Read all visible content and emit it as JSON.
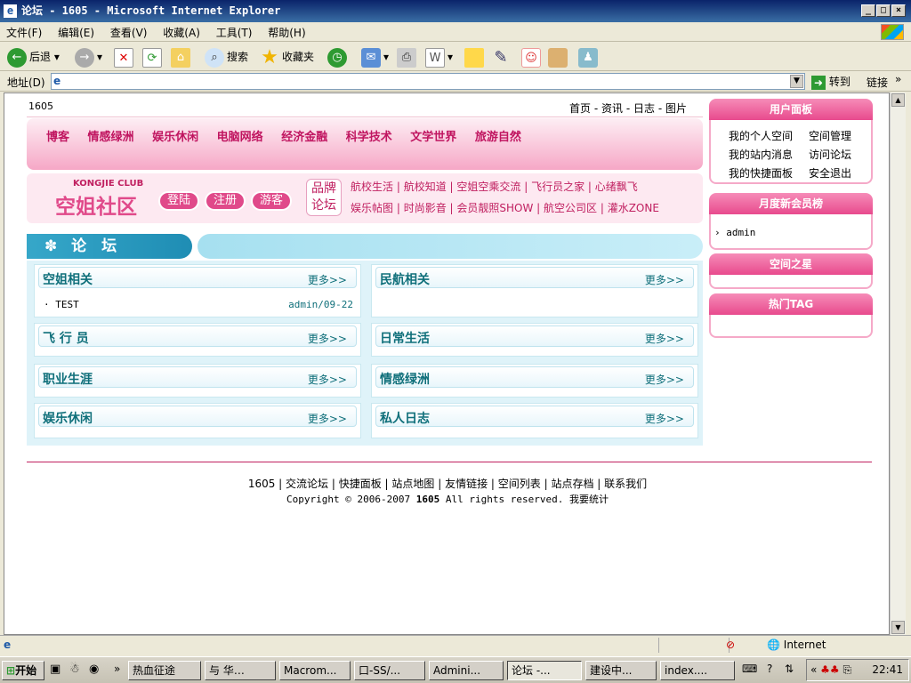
{
  "window": {
    "title": "论坛 - 1605 - Microsoft Internet Explorer",
    "menu": [
      "文件(F)",
      "编辑(E)",
      "查看(V)",
      "收藏(A)",
      "工具(T)",
      "帮助(H)"
    ],
    "toolbar": {
      "back": "后退",
      "search": "搜索",
      "favorites": "收藏夹"
    },
    "address_label": "地址(D)",
    "address_value": "",
    "go": "转到",
    "links": "链接"
  },
  "page": {
    "site_num": "1605",
    "topnav": [
      "首页",
      "资讯",
      "日志",
      "图片"
    ],
    "categories": [
      "博客",
      "情感绿洲",
      "娱乐休闲",
      "电脑网络",
      "经济金融",
      "科学技术",
      "文学世界",
      "旅游自然"
    ],
    "logo_en": "KONGJIE CLUB",
    "logo_cn": "空姐社区",
    "btn_login": "登陆",
    "btn_register": "注册",
    "btn_guest": "游客",
    "brand_label_1": "品牌",
    "brand_label_2": "论坛",
    "brand_links_row1": [
      "航校生活",
      "航校知道",
      "空姐空乘交流",
      "飞行员之家",
      "心绪飘飞"
    ],
    "brand_links_row2": [
      "娱乐帖图",
      "时尚影音",
      "会员靓照SHOW",
      "航空公司区",
      "灌水ZONE"
    ],
    "forum_title": "论　坛",
    "forums": [
      {
        "title": "空姐相关",
        "more": "更多>>",
        "posts": [
          {
            "title": "TEST",
            "meta": "admin/09-22"
          }
        ]
      },
      {
        "title": "民航相关",
        "more": "更多>>",
        "posts": []
      },
      {
        "title": "飞 行 员",
        "more": "更多>>",
        "posts": []
      },
      {
        "title": "日常生活",
        "more": "更多>>",
        "posts": []
      },
      {
        "title": "职业生涯",
        "more": "更多>>",
        "posts": []
      },
      {
        "title": "情感绿洲",
        "more": "更多>>",
        "posts": []
      },
      {
        "title": "娱乐休闲",
        "more": "更多>>",
        "posts": []
      },
      {
        "title": "私人日志",
        "more": "更多>>",
        "posts": []
      }
    ],
    "side": {
      "user_panel": "用户面板",
      "user_links": [
        "我的个人空间",
        "空间管理",
        "我的站内消息",
        "访问论坛",
        "我的快捷面板",
        "安全退出"
      ],
      "monthly": "月度新会员榜",
      "monthly_items": [
        "admin"
      ],
      "star": "空间之星",
      "hot_tag": "热门TAG"
    },
    "footer_links": [
      "1605",
      "交流论坛",
      "快捷面板",
      "站点地图",
      "友情链接",
      "空间列表",
      "站点存档",
      "联系我们"
    ],
    "copyright_pre": "Copyright © 2006-2007 ",
    "copyright_brand": "1605",
    "copyright_post": " All rights reserved. 我要统计"
  },
  "status": {
    "zone": "Internet"
  },
  "taskbar": {
    "start": "开始",
    "tasks": [
      "热血征途",
      "与 华…",
      "Macrom...",
      "口-SS/...",
      "Admini...",
      "论坛 -...",
      "建设中...",
      "index...."
    ],
    "clock": "22:41"
  }
}
